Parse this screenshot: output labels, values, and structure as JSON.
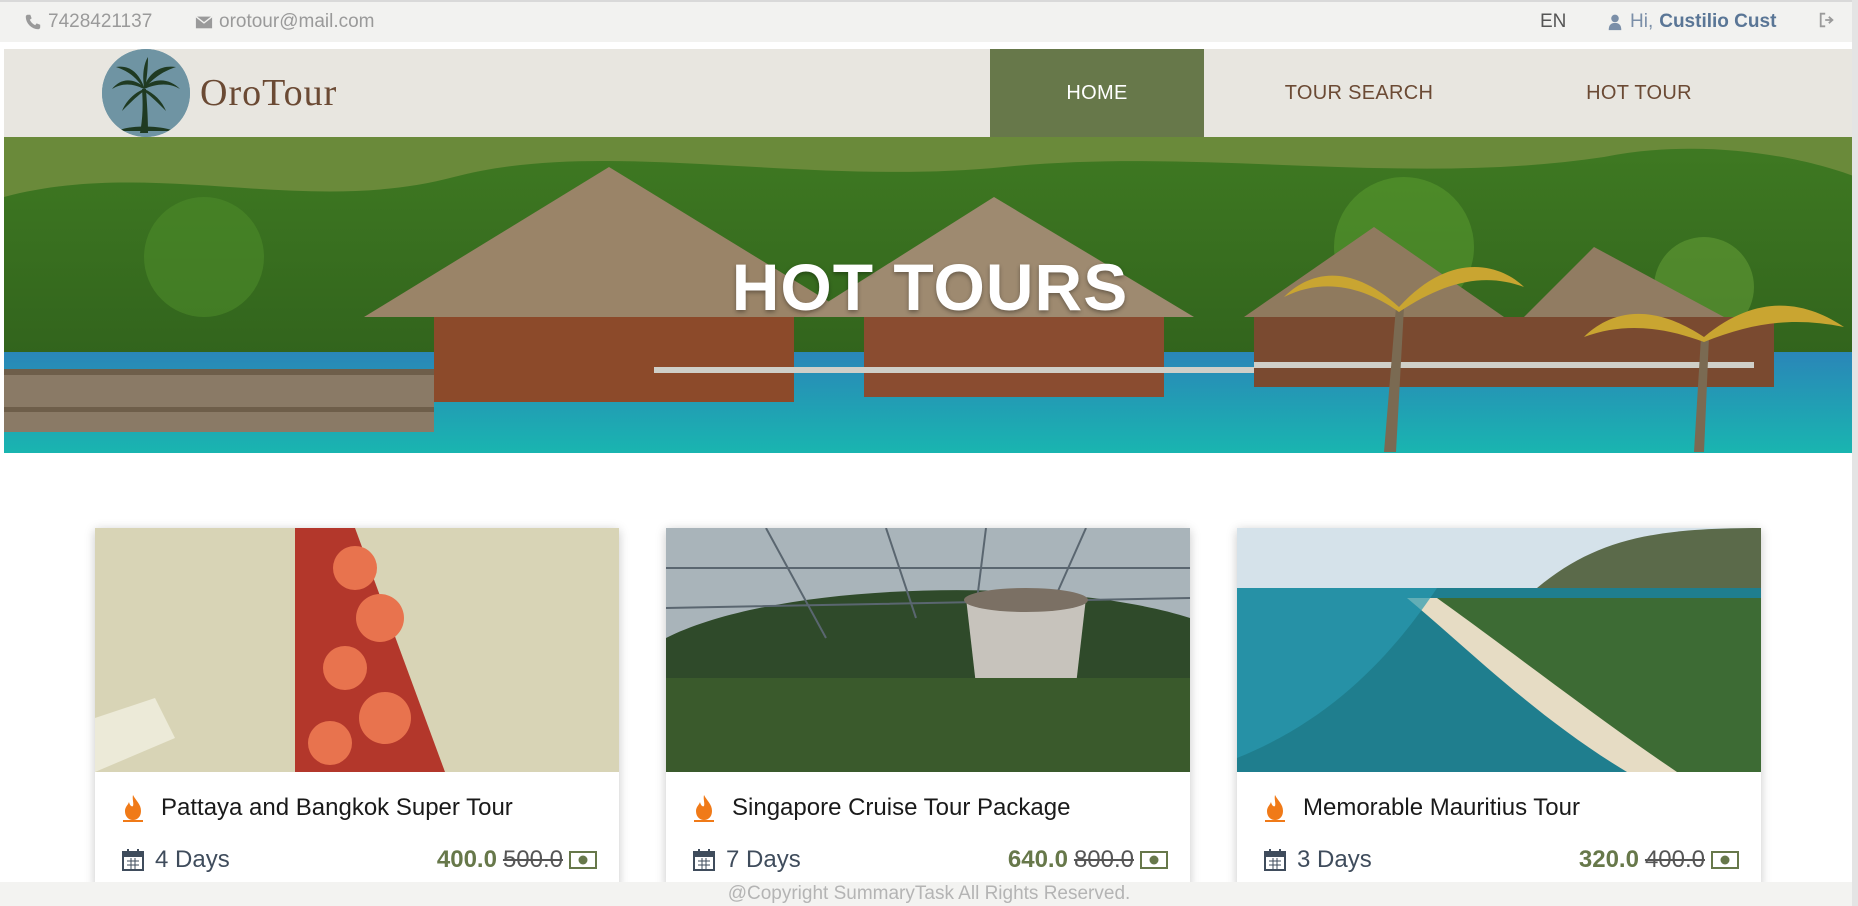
{
  "topbar": {
    "phone": "7428421137",
    "email": "orotour@mail.com",
    "language": "EN",
    "greeting": "Hi,",
    "user_name": "Custilio Cust"
  },
  "nav": {
    "brand": "OroTour",
    "items": [
      {
        "label": "HOME",
        "active": true
      },
      {
        "label": "TOUR SEARCH",
        "active": false
      },
      {
        "label": "HOT TOUR",
        "active": false
      }
    ]
  },
  "hero": {
    "title": "HOT TOURS"
  },
  "tours": [
    {
      "title": "Pattaya and Bangkok Super Tour",
      "days": "4 Days",
      "price": "400.0",
      "old_price": "500.0"
    },
    {
      "title": "Singapore Cruise Tour Package",
      "days": "7 Days",
      "price": "640.0",
      "old_price": "800.0"
    },
    {
      "title": "Memorable Mauritius Tour",
      "days": "3 Days",
      "price": "320.0",
      "old_price": "400.0"
    }
  ],
  "footer": {
    "text": "@Copyright SummaryTask All Rights Reserved."
  },
  "colors": {
    "accent_green": "#67784a",
    "brand_brown": "#6b4a34",
    "flame_orange": "#f07a18"
  },
  "icons": [
    "phone-icon",
    "envelope-icon",
    "user-icon",
    "logout-icon",
    "palm-logo",
    "flame-icon",
    "calendar-icon",
    "money-icon"
  ]
}
